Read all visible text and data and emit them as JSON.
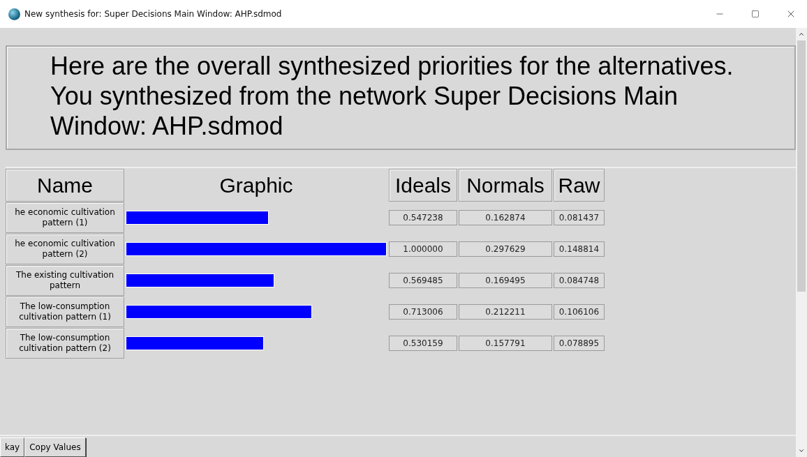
{
  "window": {
    "title": "New synthesis for: Super Decisions Main Window: AHP.sdmod"
  },
  "message": "Here are the overall synthesized priorities for the alternatives. You synthesized from the network Super Decisions Main Window: AHP.sdmod",
  "table": {
    "columns": [
      "Name",
      "Graphic",
      "Ideals",
      "Normals",
      "Raw"
    ],
    "rows": [
      {
        "name": "he economic cultivation pattern (1)",
        "ideals": "0.547238",
        "normals": "0.162874",
        "raw": "0.081437"
      },
      {
        "name": "he economic cultivation pattern (2)",
        "ideals": "1.000000",
        "normals": "0.297629",
        "raw": "0.148814"
      },
      {
        "name": "The existing cultivation pattern",
        "ideals": "0.569485",
        "normals": "0.169495",
        "raw": "0.084748"
      },
      {
        "name": "The low-consumption cultivation pattern (1)",
        "ideals": "0.713006",
        "normals": "0.212211",
        "raw": "0.106106"
      },
      {
        "name": "The low-consumption cultivation pattern (2)",
        "ideals": "0.530159",
        "normals": "0.157791",
        "raw": "0.078895"
      }
    ]
  },
  "buttons": [
    "kay",
    "Copy Values"
  ]
}
